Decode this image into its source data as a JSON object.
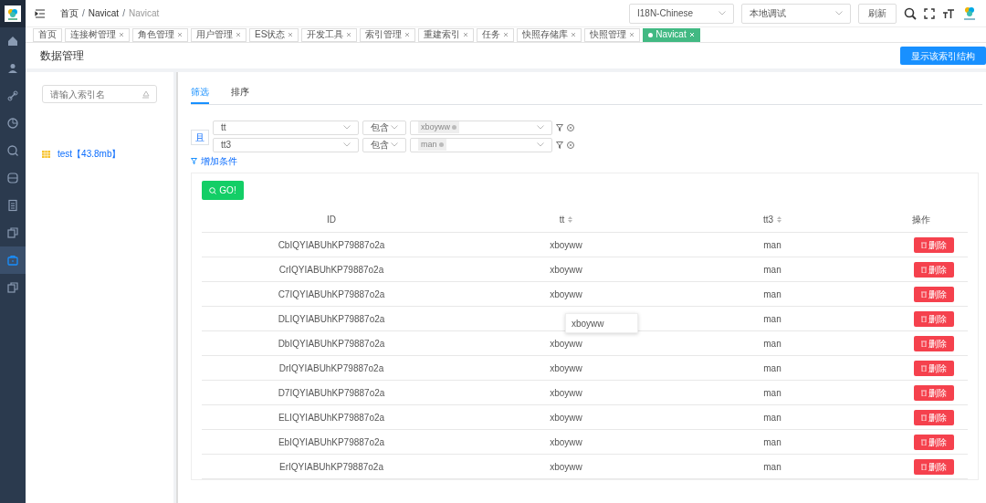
{
  "sidebar": {
    "items": [
      {
        "selected": false
      },
      {
        "selected": false
      },
      {
        "selected": false
      },
      {
        "selected": false
      },
      {
        "selected": false
      },
      {
        "selected": false
      },
      {
        "selected": false
      },
      {
        "selected": false
      },
      {
        "selected": true
      },
      {
        "selected": false
      }
    ]
  },
  "breadcrumb": [
    {
      "label": "首页"
    },
    {
      "separator": "/",
      "label": "Navicat"
    },
    {
      "separator": "/",
      "label": "Navicat"
    }
  ],
  "header": {
    "language": "I18N-Chinese",
    "environment": "本地调试",
    "refresh": "刷新"
  },
  "tabs": [
    {
      "label": "首页",
      "selected": false,
      "closable": false
    },
    {
      "label": "连接树管理",
      "selected": false,
      "closable": true
    },
    {
      "label": "角色管理",
      "selected": false,
      "closable": true
    },
    {
      "label": "用户管理",
      "selected": false,
      "closable": true
    },
    {
      "label": "ES状态",
      "selected": false,
      "closable": true
    },
    {
      "label": "开发工具",
      "selected": false,
      "closable": true
    },
    {
      "label": "索引管理",
      "selected": false,
      "closable": true
    },
    {
      "label": "重建索引",
      "selected": false,
      "closable": true
    },
    {
      "label": "任务",
      "selected": false,
      "closable": true
    },
    {
      "label": "快照存储库",
      "selected": false,
      "closable": true
    },
    {
      "label": "快照管理",
      "selected": false,
      "closable": true
    },
    {
      "label": "Navicat",
      "selected": true,
      "closable": true
    }
  ],
  "page_title": "数据管理",
  "structure_button": "显示该索引结构",
  "index_search": {
    "placeholder": "请输入索引名"
  },
  "indices": [
    {
      "label": "test【43.8mb】"
    }
  ],
  "filter_tabs": [
    {
      "label": "筛选",
      "selected": true
    },
    {
      "label": "排序",
      "selected": false
    }
  ],
  "logic": "且",
  "conditions": [
    {
      "field": "tt",
      "operator": "包含",
      "values": [
        "xboyww"
      ]
    },
    {
      "field": "tt3",
      "operator": "包含",
      "values": [
        "man"
      ]
    }
  ],
  "add_condition": "增加条件",
  "go_button": "GO!",
  "table": {
    "columns": [
      {
        "label": "ID",
        "sortable": false
      },
      {
        "label": "tt",
        "sortable": true
      },
      {
        "label": "tt3",
        "sortable": true
      },
      {
        "label": "操作",
        "sortable": false
      }
    ],
    "rows": [
      {
        "id": "CbIQYIABUhKP79887o2a",
        "tt": "xboyww",
        "tt3": "man",
        "action": "删除"
      },
      {
        "id": "CrIQYIABUhKP79887o2a",
        "tt": "xboyww",
        "tt3": "man",
        "action": "删除"
      },
      {
        "id": "C7IQYIABUhKP79887o2a",
        "tt": "xboyww",
        "tt3": "man",
        "action": "删除"
      },
      {
        "id": "DLIQYIABUhKP79887o2a",
        "tooltip": "xboyww",
        "tt3": "man",
        "action": "删除"
      },
      {
        "id": "DbIQYIABUhKP79887o2a",
        "tt": "xboyww",
        "tt3": "man",
        "action": "删除"
      },
      {
        "id": "DrIQYIABUhKP79887o2a",
        "tt": "xboyww",
        "tt3": "man",
        "action": "删除"
      },
      {
        "id": "D7IQYIABUhKP79887o2a",
        "tt": "xboyww",
        "tt3": "man",
        "action": "删除"
      },
      {
        "id": "ELIQYIABUhKP79887o2a",
        "tt": "xboyww",
        "tt3": "man",
        "action": "删除"
      },
      {
        "id": "EbIQYIABUhKP79887o2a",
        "tt": "xboyww",
        "tt3": "man",
        "action": "删除"
      },
      {
        "id": "ErIQYIABUhKP79887o2a",
        "tt": "xboyww",
        "tt3": "man",
        "action": "删除"
      }
    ]
  }
}
